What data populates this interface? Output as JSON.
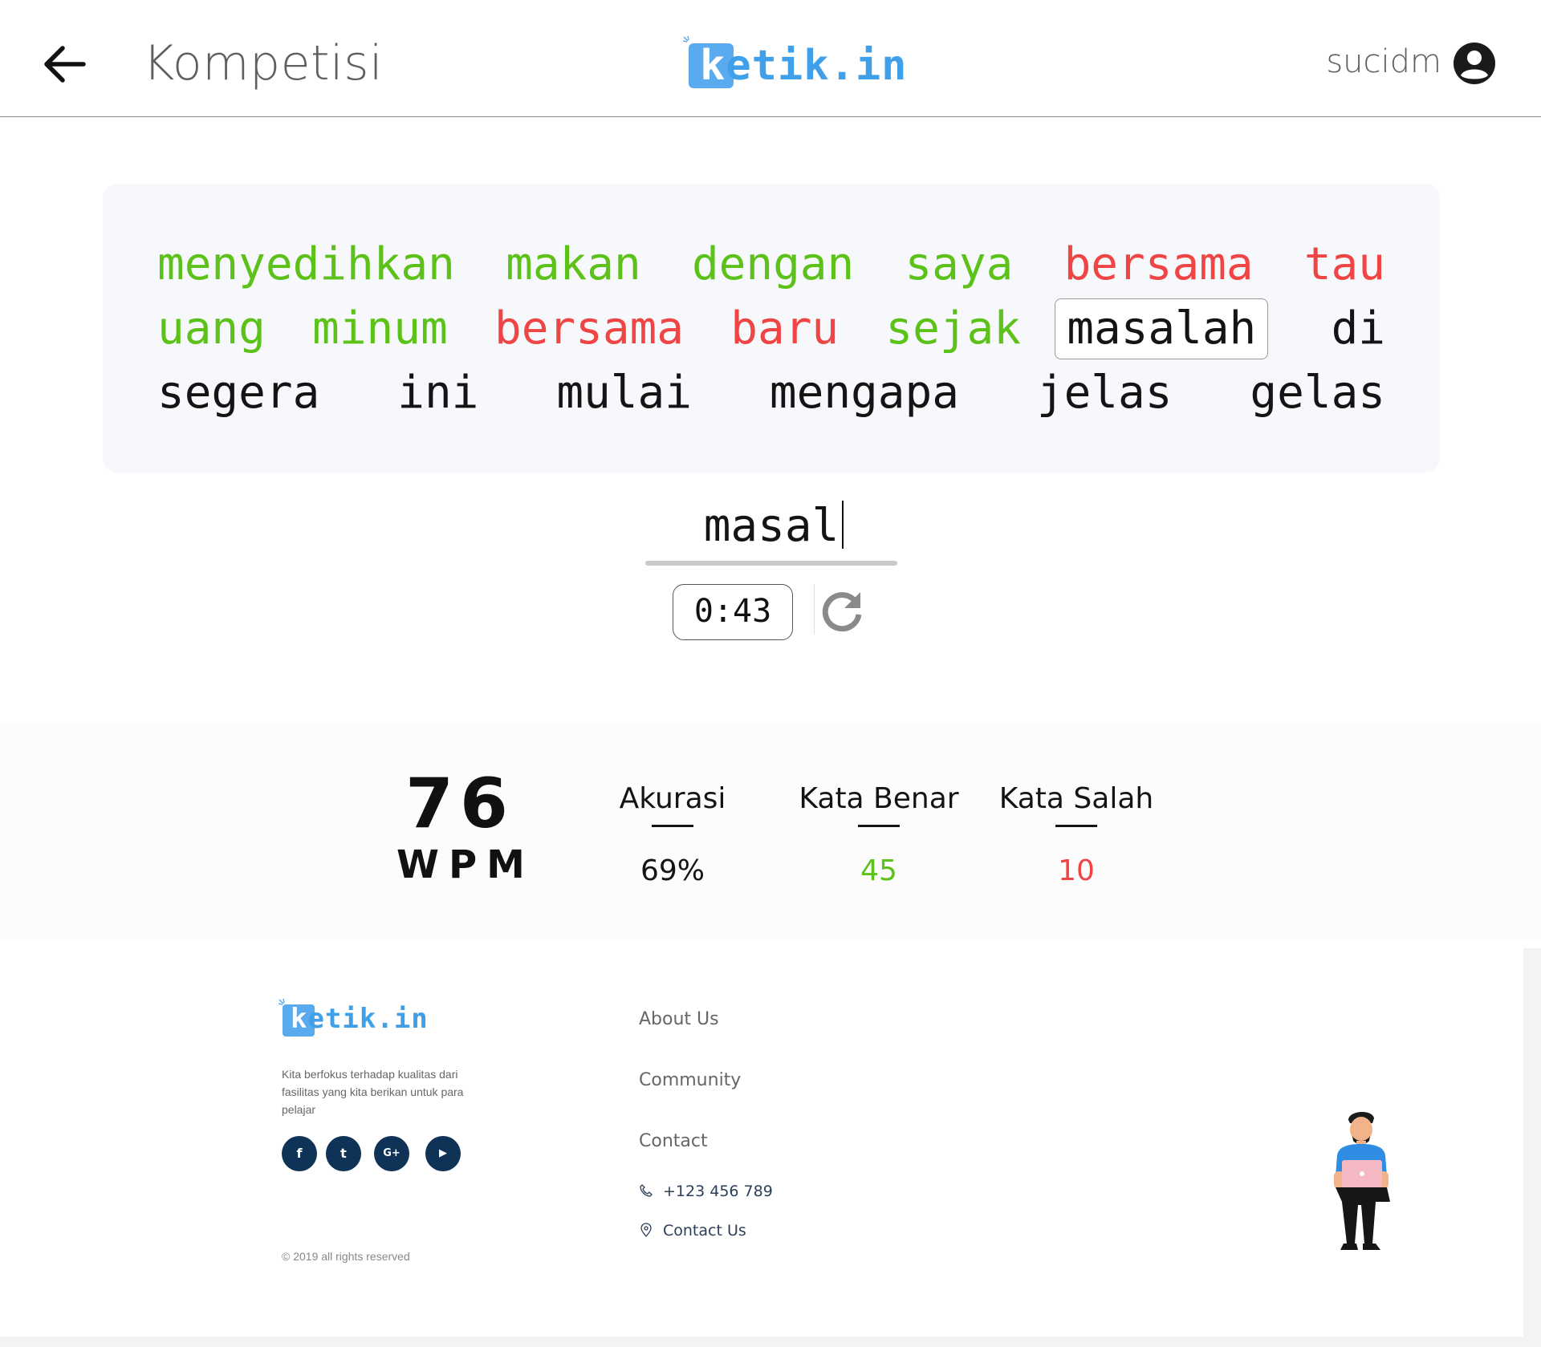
{
  "header": {
    "back_label": "back",
    "title": "Kompetisi",
    "logo": {
      "first": "k",
      "rest": "etik.in"
    },
    "username": "sucidm"
  },
  "typing": {
    "words": [
      {
        "text": "menyedihkan",
        "status": "correct"
      },
      {
        "text": "makan",
        "status": "correct"
      },
      {
        "text": "dengan",
        "status": "correct"
      },
      {
        "text": "saya",
        "status": "correct"
      },
      {
        "text": "bersama",
        "status": "wrong"
      },
      {
        "text": "tau",
        "status": "wrong"
      },
      {
        "text": "uang",
        "status": "correct"
      },
      {
        "text": "minum",
        "status": "correct"
      },
      {
        "text": "bersama",
        "status": "wrong"
      },
      {
        "text": "baru",
        "status": "wrong"
      },
      {
        "text": "sejak",
        "status": "correct"
      },
      {
        "text": "masalah",
        "status": "current"
      },
      {
        "text": "di",
        "status": "pending"
      },
      {
        "text": "segera",
        "status": "pending"
      },
      {
        "text": "ini",
        "status": "pending"
      },
      {
        "text": "mulai",
        "status": "pending"
      },
      {
        "text": "mengapa",
        "status": "pending"
      },
      {
        "text": "jelas",
        "status": "pending"
      },
      {
        "text": "gelas",
        "status": "pending"
      }
    ],
    "input_value": "masal",
    "timer": "0:43"
  },
  "stats": {
    "wpm_value": "76",
    "wpm_label": "WPM",
    "accuracy_label": "Akurasi",
    "accuracy_value": "69%",
    "correct_label": "Kata Benar",
    "correct_value": "45",
    "wrong_label": "Kata Salah",
    "wrong_value": "10"
  },
  "footer": {
    "logo": {
      "first": "k",
      "rest": "etik.in"
    },
    "description": "Kita berfokus terhadap kualitas dari fasilitas yang kita berikan untuk para pelajar",
    "social": [
      "f",
      "t",
      "G+",
      "▶"
    ],
    "copyright": "© 2019 all rights reserved",
    "links": [
      "About Us",
      "Community",
      "Contact"
    ],
    "phone": "+123 456 789",
    "contact_us": "Contact Us"
  },
  "colors": {
    "correct": "#5cc21a",
    "wrong": "#ef4545",
    "brand": "#3f9fe8",
    "social_bg": "#0e3356"
  },
  "icons": [
    "arrow-left-icon",
    "account-circle-icon",
    "reload-icon",
    "facebook-icon",
    "twitter-icon",
    "google-plus-icon",
    "youtube-icon",
    "phone-icon",
    "location-pin-icon"
  ]
}
